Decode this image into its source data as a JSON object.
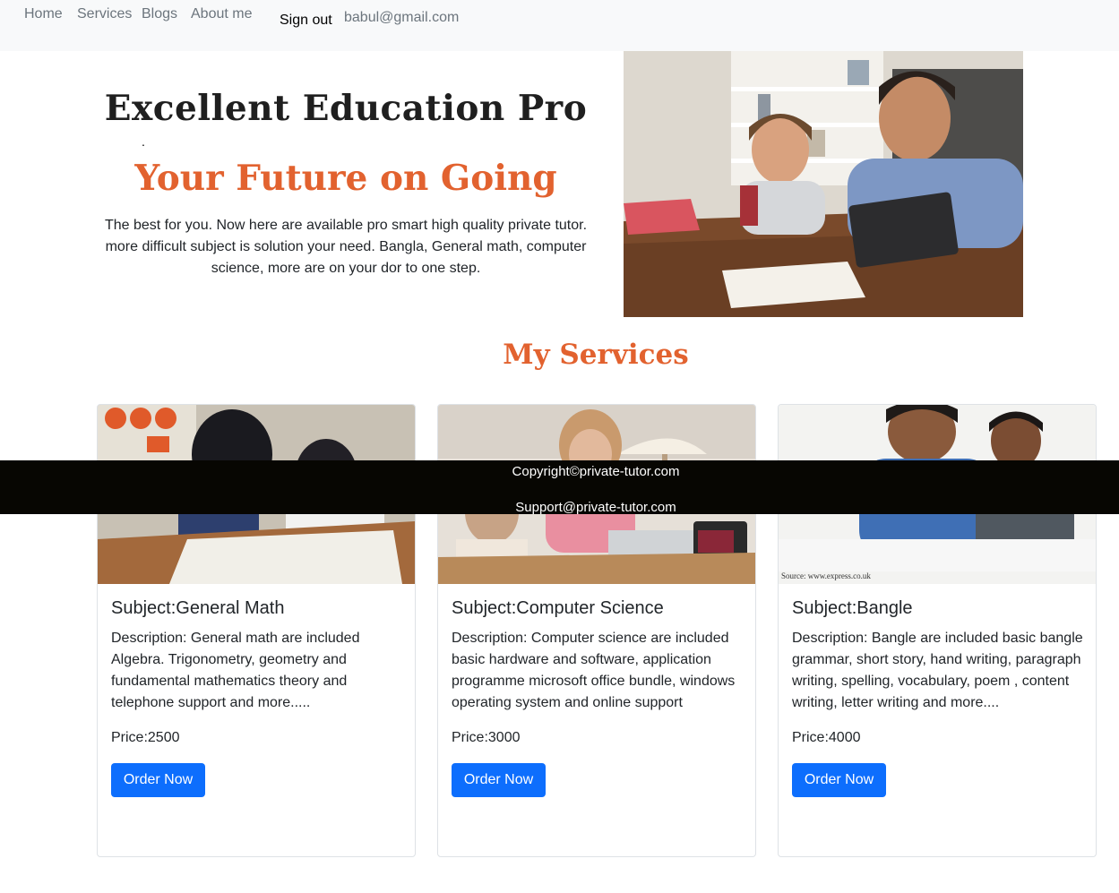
{
  "nav": {
    "links": [
      "Home",
      "Services",
      "Blogs",
      "About me"
    ],
    "signout": "Sign out",
    "email": "babul@gmail.com"
  },
  "hero": {
    "title": "Excellent Education Pro",
    "dot": ".",
    "subtitle": "Your Future on Going",
    "text": "The best for you. Now here are available pro smart high quality private tutor. more difficult subject is solution your need. Bangla, General math, computer science, more are on your dor to one step."
  },
  "services": {
    "heading": "My Services",
    "cards": [
      {
        "title": "Subject:General Math",
        "description": "Description: General math are included Algebra. Trigonometry, geometry and fundamental mathematics theory and telephone support and more.....",
        "price": "Price:2500",
        "button": "Order Now"
      },
      {
        "title": "Subject:Computer Science",
        "description": "Description: Computer science are included basic hardware and software, application programme microsoft office bundle, windows operating system and online support",
        "price": "Price:3000",
        "button": "Order Now"
      },
      {
        "title": "Subject:Bangle",
        "description": "Description: Bangle are included basic bangle grammar, short story, hand writing, paragraph writing, spelling, vocabulary, poem , content writing, letter writing and more....",
        "price": "Price:4000",
        "button": "Order Now",
        "image_caption": "Source: www.express.co.uk"
      }
    ]
  },
  "footer": {
    "copyright": "Copyright©private-tutor.com",
    "support": "Support@private-tutor.com"
  },
  "colors": {
    "accent": "#e2622f",
    "primary_button": "#0d6efd",
    "footer_bg": "#070602",
    "navbar_bg": "#f8f9fa"
  }
}
